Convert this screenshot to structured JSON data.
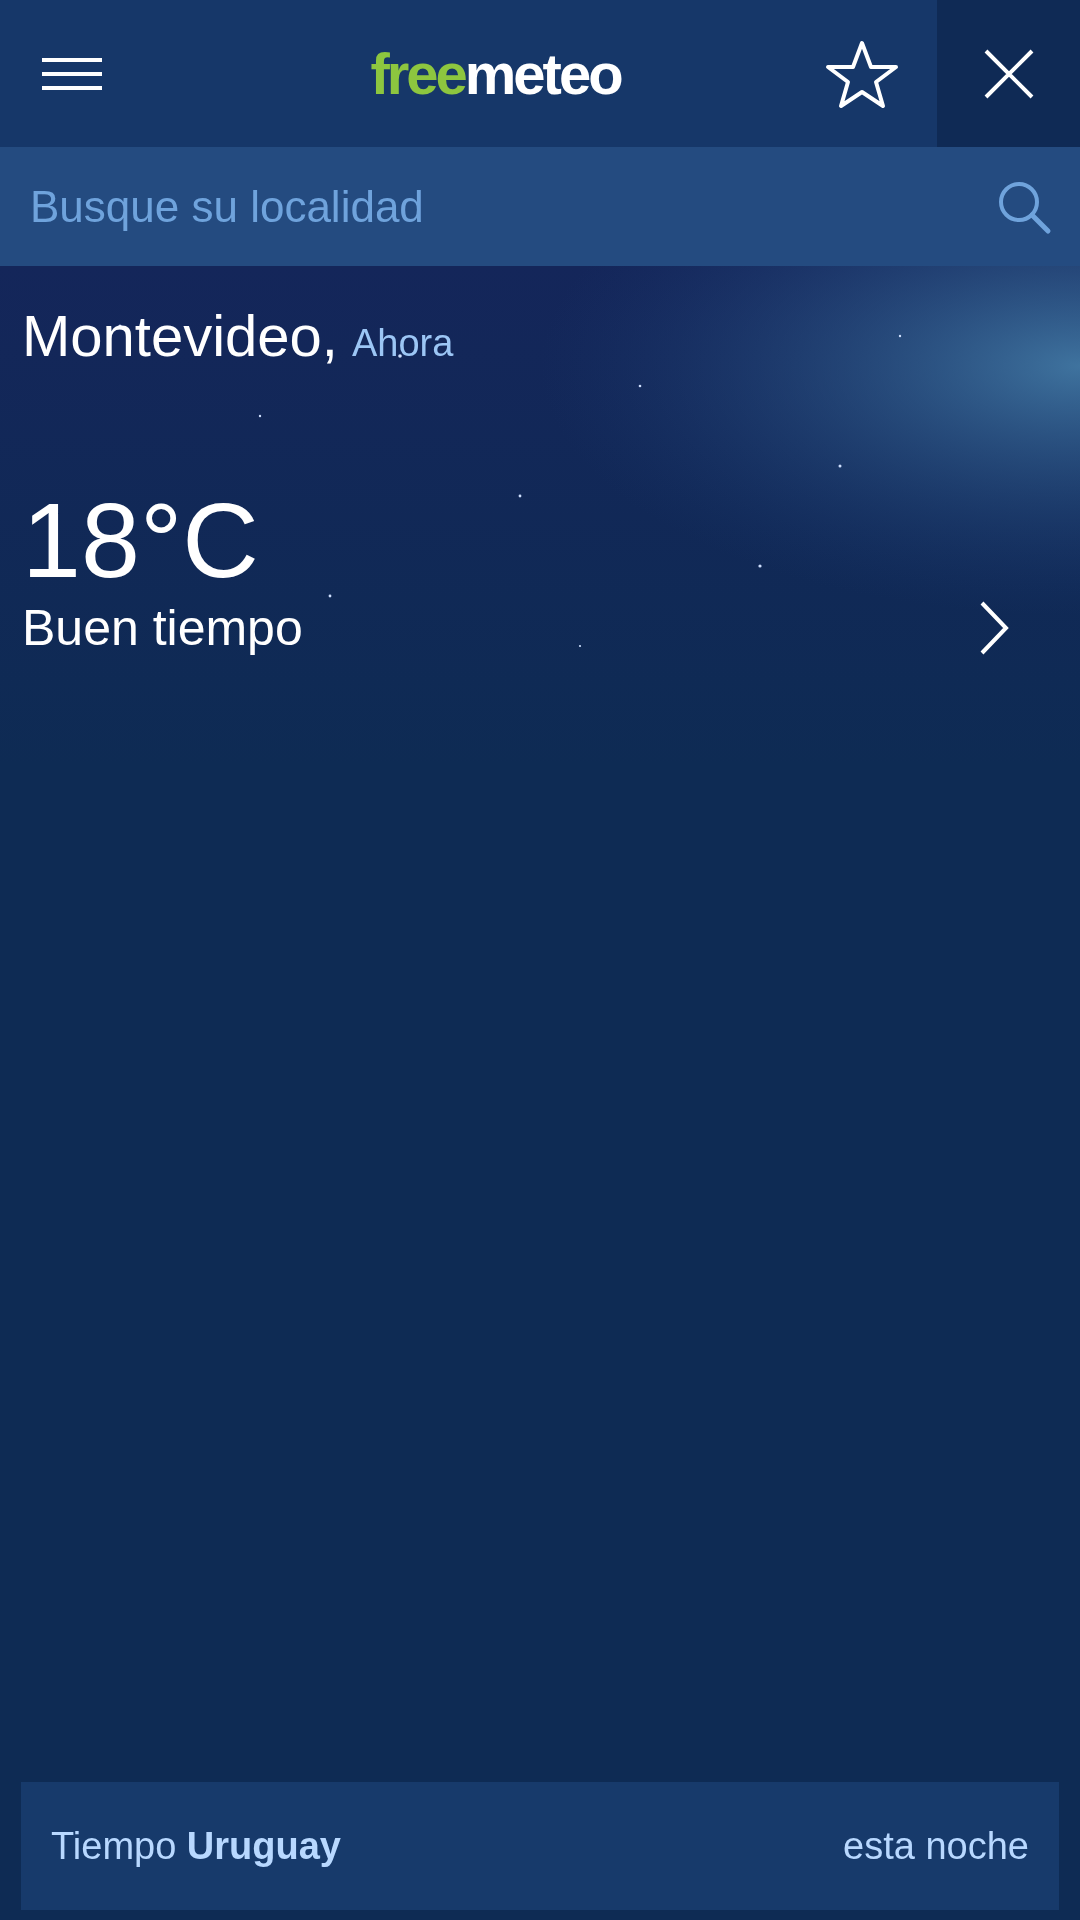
{
  "header": {
    "logo": [
      {
        "text": "free",
        "color": "#8dc63f"
      },
      {
        "text": "meteo",
        "color": "#ffffff"
      }
    ]
  },
  "search": {
    "placeholder": "Busque su localidad"
  },
  "current": {
    "location": "Montevideo,",
    "time": "Ahora",
    "temperature": "18°C",
    "condition": "Buen tiempo"
  },
  "footer": {
    "link": "Tiempo **Uruguay**",
    "period": "esta noche"
  }
}
